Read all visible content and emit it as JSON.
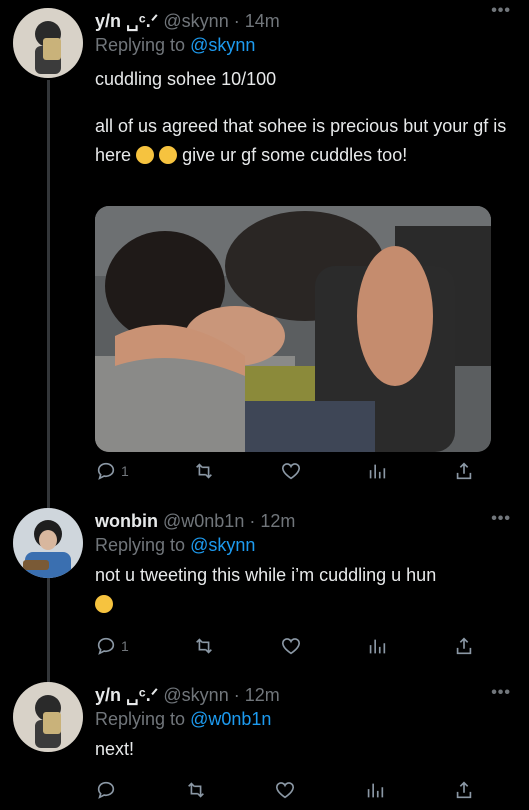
{
  "tweets": [
    {
      "name": "y/n ␣ᶜ.ᐟ",
      "handle": "@skynn",
      "dot": "·",
      "time": "14m",
      "replying_prefix": "Replying to",
      "replying_to": "@skynn",
      "text_lines": [
        "cuddling sohee 10/100",
        "all of us agreed that sohee is precious but your gf is here",
        "give ur gf some cuddles too!"
      ],
      "more": "•••",
      "replies": "1"
    },
    {
      "name": "wonbin",
      "handle": "@w0nb1n",
      "dot": "·",
      "time": "12m",
      "replying_prefix": "Replying to",
      "replying_to": "@skynn",
      "text_lines": [
        "not u tweeting this while i’m cuddling u hun"
      ],
      "more": "•••",
      "replies": "1"
    },
    {
      "name": "y/n ␣ᶜ.ᐟ",
      "handle": "@skynn",
      "dot": "·",
      "time": "12m",
      "replying_prefix": "Replying to",
      "replying_to": "@w0nb1n",
      "text_lines": [
        "next!"
      ],
      "more": "•••",
      "replies": ""
    }
  ],
  "icons": [
    "reply-icon",
    "retweet-icon",
    "like-icon",
    "views-icon",
    "share-icon"
  ],
  "colors": {
    "background": "#000000",
    "text": "#e7e9ea",
    "muted": "#71767b",
    "link": "#1d9bf0"
  }
}
